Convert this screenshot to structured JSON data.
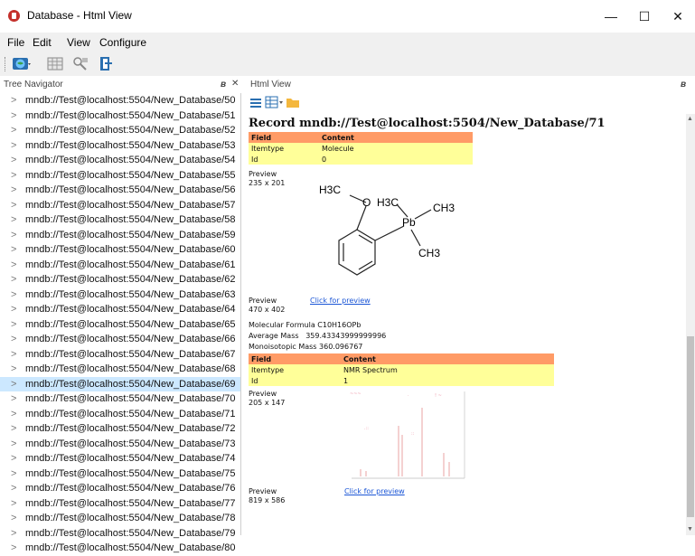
{
  "window": {
    "title": "Database - Html View",
    "minimize": "—",
    "maximize": "☐",
    "close": "✕"
  },
  "menu": [
    "File",
    "Edit",
    "View",
    "Configure"
  ],
  "tree_panel": {
    "title": "Tree Navigator",
    "pin": "᐀",
    "close": "✕"
  },
  "html_panel": {
    "title": "Html View",
    "pin": "᐀",
    "close": "✕"
  },
  "tree_items": [
    "mndb://Test@localhost:5504/New_Database/50",
    "mndb://Test@localhost:5504/New_Database/51",
    "mndb://Test@localhost:5504/New_Database/52",
    "mndb://Test@localhost:5504/New_Database/53",
    "mndb://Test@localhost:5504/New_Database/54",
    "mndb://Test@localhost:5504/New_Database/55",
    "mndb://Test@localhost:5504/New_Database/56",
    "mndb://Test@localhost:5504/New_Database/57",
    "mndb://Test@localhost:5504/New_Database/58",
    "mndb://Test@localhost:5504/New_Database/59",
    "mndb://Test@localhost:5504/New_Database/60",
    "mndb://Test@localhost:5504/New_Database/61",
    "mndb://Test@localhost:5504/New_Database/62",
    "mndb://Test@localhost:5504/New_Database/63",
    "mndb://Test@localhost:5504/New_Database/64",
    "mndb://Test@localhost:5504/New_Database/65",
    "mndb://Test@localhost:5504/New_Database/66",
    "mndb://Test@localhost:5504/New_Database/67",
    "mndb://Test@localhost:5504/New_Database/68",
    "mndb://Test@localhost:5504/New_Database/69",
    "mndb://Test@localhost:5504/New_Database/70",
    "mndb://Test@localhost:5504/New_Database/71",
    "mndb://Test@localhost:5504/New_Database/72",
    "mndb://Test@localhost:5504/New_Database/73",
    "mndb://Test@localhost:5504/New_Database/74",
    "mndb://Test@localhost:5504/New_Database/75",
    "mndb://Test@localhost:5504/New_Database/76",
    "mndb://Test@localhost:5504/New_Database/77",
    "mndb://Test@localhost:5504/New_Database/78",
    "mndb://Test@localhost:5504/New_Database/79",
    "mndb://Test@localhost:5504/New_Database/80"
  ],
  "selected_index": 19,
  "record": {
    "title": "Record mndb://Test@localhost:5504/New_Database/71",
    "table1": {
      "header": [
        "Field",
        "Content"
      ],
      "rows": [
        [
          "Itemtype",
          "Molecule"
        ],
        [
          "Id",
          "0"
        ]
      ]
    },
    "preview1": {
      "label": "Preview",
      "size": "235 x 201"
    },
    "molecule_labels": {
      "h3c_o": "H3C",
      "o": "O",
      "h3c": "H3C",
      "pb": "Pb",
      "ch3_top": "CH3",
      "ch3_bottom": "CH3"
    },
    "preview2": {
      "label": "Preview",
      "size": "470 x 402",
      "link": "Click for preview"
    },
    "props": [
      [
        "Molecular Formula",
        "C10H16OPb"
      ],
      [
        "Average Mass",
        "359.43343999999996"
      ],
      [
        "Monoisotopic Mass",
        "360.096767"
      ]
    ],
    "table2": {
      "header": [
        "Field",
        "Content"
      ],
      "rows": [
        [
          "Itemtype",
          "NMR Spectrum"
        ],
        [
          "Id",
          "1"
        ]
      ]
    },
    "preview3": {
      "label": "Preview",
      "size": "205 x 147"
    },
    "preview4": {
      "label": "Preview",
      "size": "819 x 586",
      "link": "Click for preview"
    }
  },
  "colors": {
    "header_row": "#ff9b66",
    "data_row": "#ffff99",
    "selected_tree": "#cce8ff",
    "link": "#1a55d6"
  }
}
